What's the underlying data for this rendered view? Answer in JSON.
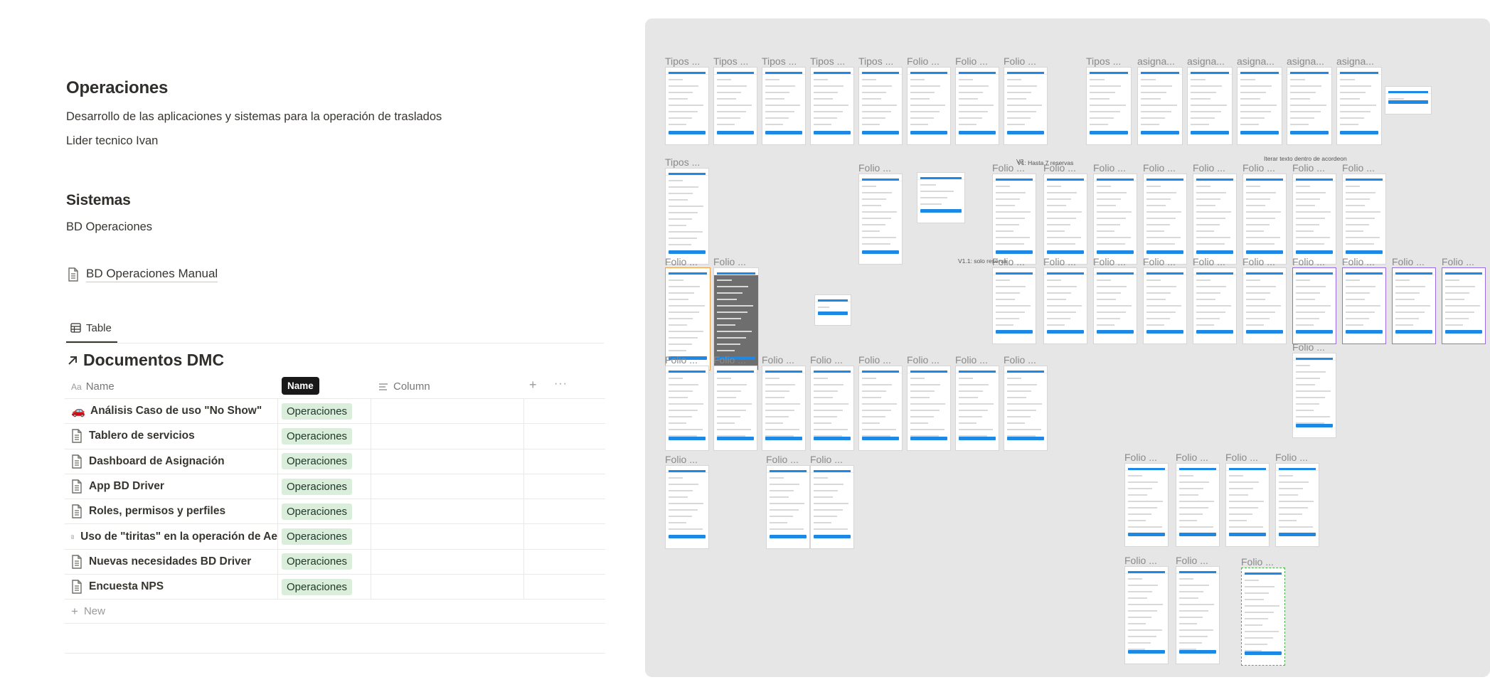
{
  "doc": {
    "title": "Operaciones",
    "description": "Desarrollo de las aplicaciones y sistemas para la operación de traslados",
    "lead": "Lider tecnico Ivan",
    "systems_heading": "Sistemas",
    "systems_text": "BD Operaciones",
    "manual_link": "BD Operaciones Manual"
  },
  "view_tab": {
    "label": "Table",
    "icon": "table-icon"
  },
  "database": {
    "title": "Documentos DMC",
    "title_icon": "arrow-up-right-icon",
    "columns": {
      "name": "Name",
      "name_tooltip": "Name",
      "column": "Column"
    },
    "rows": [
      {
        "icon": "🚗",
        "name": "Análisis Caso de uso \"No Show\"",
        "tag": "Operaciones"
      },
      {
        "icon": "doc",
        "name": "Tablero de servicios",
        "tag": "Operaciones"
      },
      {
        "icon": "doc",
        "name": "Dashboard de Asignación",
        "tag": "Operaciones"
      },
      {
        "icon": "doc",
        "name": "App BD Driver",
        "tag": "Operaciones"
      },
      {
        "icon": "doc",
        "name": "Roles, permisos y perfiles",
        "tag": "Operaciones"
      },
      {
        "icon": "doc",
        "name": "Uso de \"tiritas\" en la operación de Ae",
        "tag": "Operaciones"
      },
      {
        "icon": "doc",
        "name": "Nuevas necesidades BD Driver",
        "tag": "Operaciones"
      },
      {
        "icon": "doc",
        "name": "Encuesta NPS",
        "tag": "Operaciones"
      }
    ],
    "new_label": "New"
  },
  "colors": {
    "tag_bg": "#dbeddb",
    "tag_text": "#1c3829",
    "canvas_bg": "#e6e6e6",
    "accent_blue": "#1e88e5"
  },
  "canvas": {
    "frame_label_tipos": "Tipos ...",
    "frame_label_folio": "Folio ...",
    "frame_label_asigna": "asigna...",
    "cap_v2": "V2",
    "cap_v1_hasta": "V1: Hasta 7 reservas",
    "cap_v1_solo": "V1.1: solo reserva",
    "cap_iterar": "Iterar texto  dentro de acordeon"
  }
}
